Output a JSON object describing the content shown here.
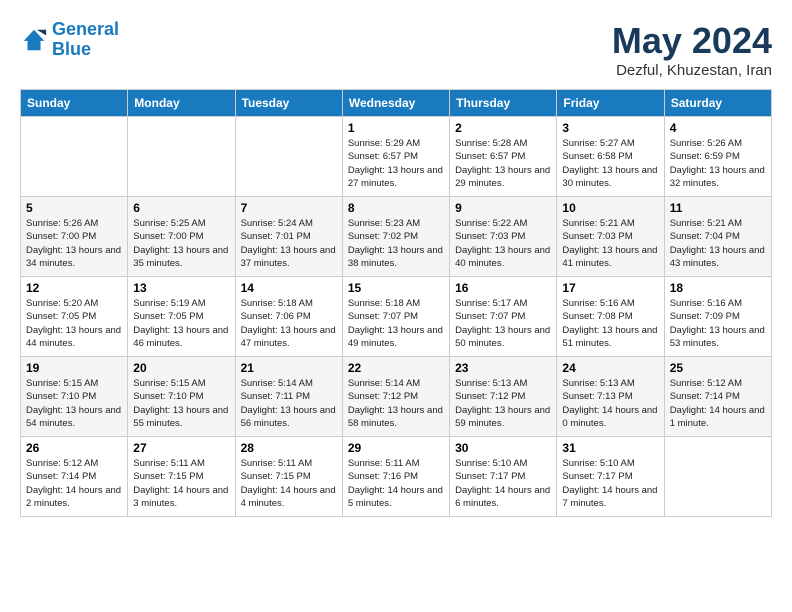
{
  "logo": {
    "line1": "General",
    "line2": "Blue"
  },
  "title": "May 2024",
  "subtitle": "Dezful, Khuzestan, Iran",
  "days_of_week": [
    "Sunday",
    "Monday",
    "Tuesday",
    "Wednesday",
    "Thursday",
    "Friday",
    "Saturday"
  ],
  "weeks": [
    [
      {
        "day": "",
        "info": ""
      },
      {
        "day": "",
        "info": ""
      },
      {
        "day": "",
        "info": ""
      },
      {
        "day": "1",
        "info": "Sunrise: 5:29 AM\nSunset: 6:57 PM\nDaylight: 13 hours and 27 minutes."
      },
      {
        "day": "2",
        "info": "Sunrise: 5:28 AM\nSunset: 6:57 PM\nDaylight: 13 hours and 29 minutes."
      },
      {
        "day": "3",
        "info": "Sunrise: 5:27 AM\nSunset: 6:58 PM\nDaylight: 13 hours and 30 minutes."
      },
      {
        "day": "4",
        "info": "Sunrise: 5:26 AM\nSunset: 6:59 PM\nDaylight: 13 hours and 32 minutes."
      }
    ],
    [
      {
        "day": "5",
        "info": "Sunrise: 5:26 AM\nSunset: 7:00 PM\nDaylight: 13 hours and 34 minutes."
      },
      {
        "day": "6",
        "info": "Sunrise: 5:25 AM\nSunset: 7:00 PM\nDaylight: 13 hours and 35 minutes."
      },
      {
        "day": "7",
        "info": "Sunrise: 5:24 AM\nSunset: 7:01 PM\nDaylight: 13 hours and 37 minutes."
      },
      {
        "day": "8",
        "info": "Sunrise: 5:23 AM\nSunset: 7:02 PM\nDaylight: 13 hours and 38 minutes."
      },
      {
        "day": "9",
        "info": "Sunrise: 5:22 AM\nSunset: 7:03 PM\nDaylight: 13 hours and 40 minutes."
      },
      {
        "day": "10",
        "info": "Sunrise: 5:21 AM\nSunset: 7:03 PM\nDaylight: 13 hours and 41 minutes."
      },
      {
        "day": "11",
        "info": "Sunrise: 5:21 AM\nSunset: 7:04 PM\nDaylight: 13 hours and 43 minutes."
      }
    ],
    [
      {
        "day": "12",
        "info": "Sunrise: 5:20 AM\nSunset: 7:05 PM\nDaylight: 13 hours and 44 minutes."
      },
      {
        "day": "13",
        "info": "Sunrise: 5:19 AM\nSunset: 7:05 PM\nDaylight: 13 hours and 46 minutes."
      },
      {
        "day": "14",
        "info": "Sunrise: 5:18 AM\nSunset: 7:06 PM\nDaylight: 13 hours and 47 minutes."
      },
      {
        "day": "15",
        "info": "Sunrise: 5:18 AM\nSunset: 7:07 PM\nDaylight: 13 hours and 49 minutes."
      },
      {
        "day": "16",
        "info": "Sunrise: 5:17 AM\nSunset: 7:07 PM\nDaylight: 13 hours and 50 minutes."
      },
      {
        "day": "17",
        "info": "Sunrise: 5:16 AM\nSunset: 7:08 PM\nDaylight: 13 hours and 51 minutes."
      },
      {
        "day": "18",
        "info": "Sunrise: 5:16 AM\nSunset: 7:09 PM\nDaylight: 13 hours and 53 minutes."
      }
    ],
    [
      {
        "day": "19",
        "info": "Sunrise: 5:15 AM\nSunset: 7:10 PM\nDaylight: 13 hours and 54 minutes."
      },
      {
        "day": "20",
        "info": "Sunrise: 5:15 AM\nSunset: 7:10 PM\nDaylight: 13 hours and 55 minutes."
      },
      {
        "day": "21",
        "info": "Sunrise: 5:14 AM\nSunset: 7:11 PM\nDaylight: 13 hours and 56 minutes."
      },
      {
        "day": "22",
        "info": "Sunrise: 5:14 AM\nSunset: 7:12 PM\nDaylight: 13 hours and 58 minutes."
      },
      {
        "day": "23",
        "info": "Sunrise: 5:13 AM\nSunset: 7:12 PM\nDaylight: 13 hours and 59 minutes."
      },
      {
        "day": "24",
        "info": "Sunrise: 5:13 AM\nSunset: 7:13 PM\nDaylight: 14 hours and 0 minutes."
      },
      {
        "day": "25",
        "info": "Sunrise: 5:12 AM\nSunset: 7:14 PM\nDaylight: 14 hours and 1 minute."
      }
    ],
    [
      {
        "day": "26",
        "info": "Sunrise: 5:12 AM\nSunset: 7:14 PM\nDaylight: 14 hours and 2 minutes."
      },
      {
        "day": "27",
        "info": "Sunrise: 5:11 AM\nSunset: 7:15 PM\nDaylight: 14 hours and 3 minutes."
      },
      {
        "day": "28",
        "info": "Sunrise: 5:11 AM\nSunset: 7:15 PM\nDaylight: 14 hours and 4 minutes."
      },
      {
        "day": "29",
        "info": "Sunrise: 5:11 AM\nSunset: 7:16 PM\nDaylight: 14 hours and 5 minutes."
      },
      {
        "day": "30",
        "info": "Sunrise: 5:10 AM\nSunset: 7:17 PM\nDaylight: 14 hours and 6 minutes."
      },
      {
        "day": "31",
        "info": "Sunrise: 5:10 AM\nSunset: 7:17 PM\nDaylight: 14 hours and 7 minutes."
      },
      {
        "day": "",
        "info": ""
      }
    ]
  ]
}
